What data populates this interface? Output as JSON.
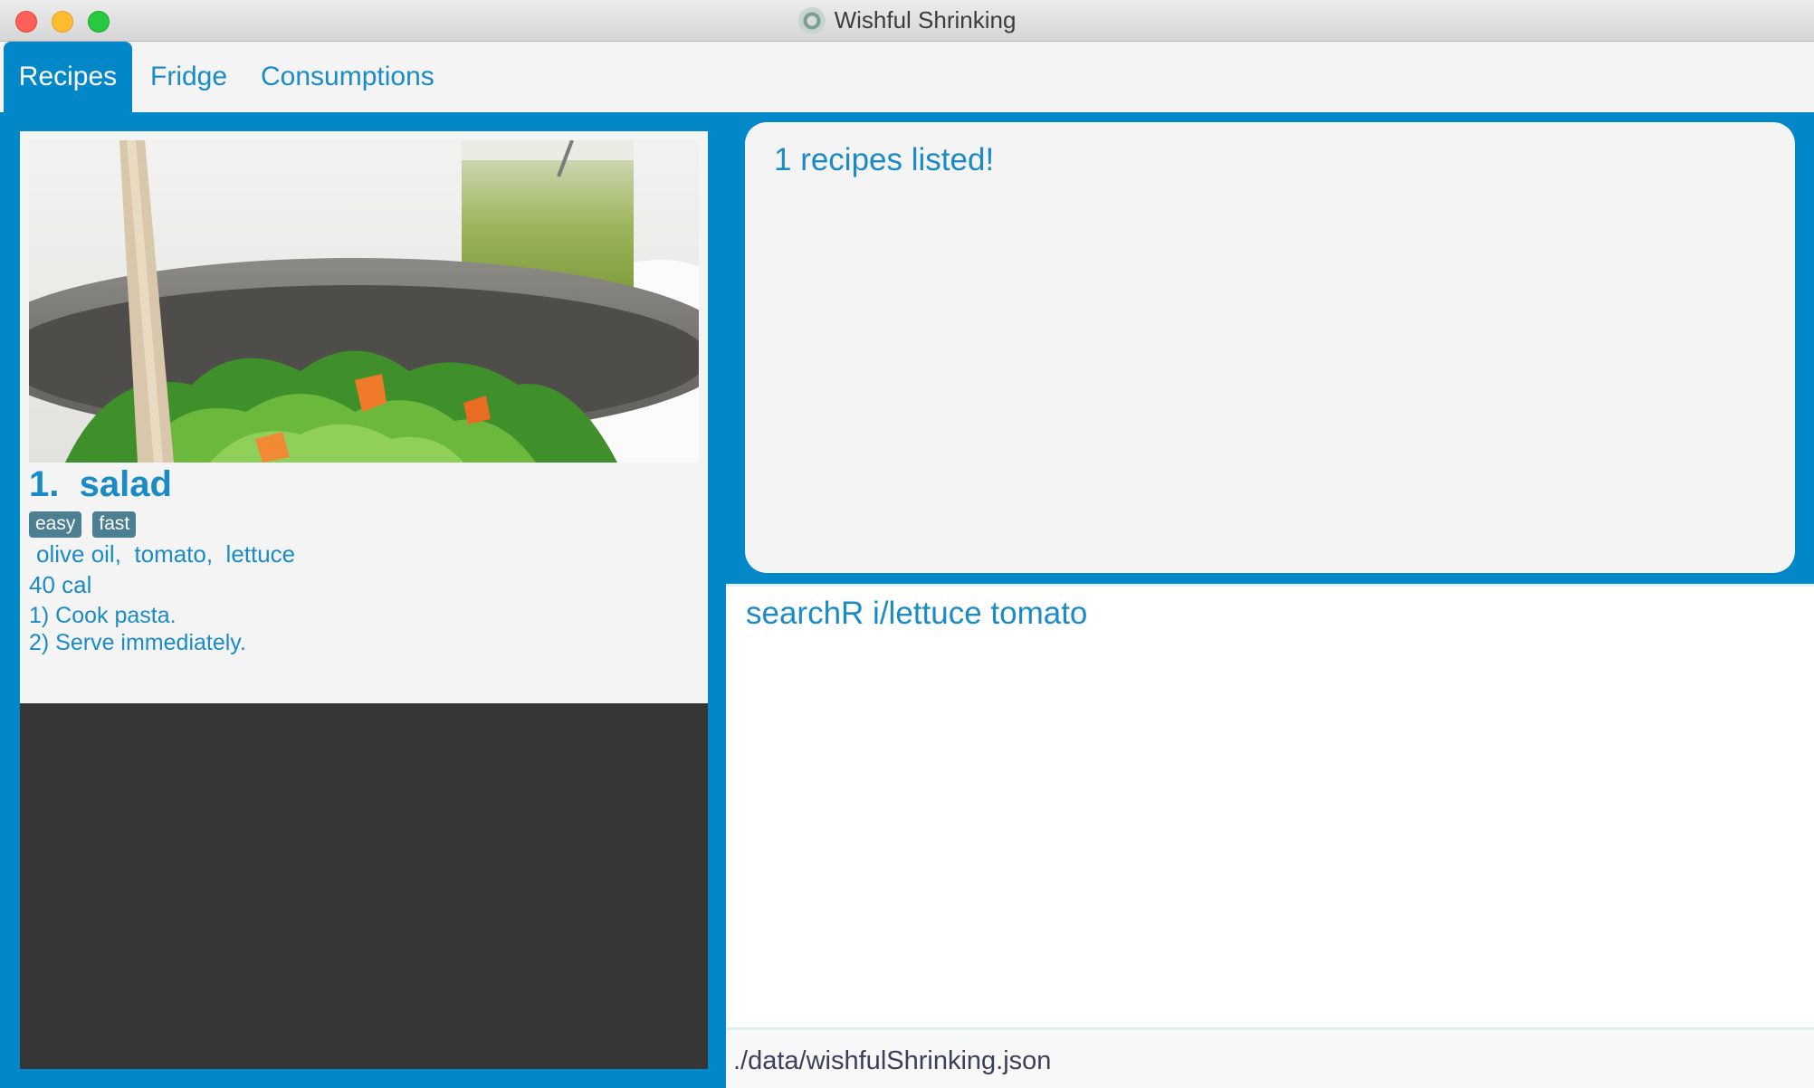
{
  "window": {
    "title": "Wishful Shrinking"
  },
  "tabs": [
    {
      "label": "Recipes",
      "active": true
    },
    {
      "label": "Fridge",
      "active": false
    },
    {
      "label": "Consumptions",
      "active": false
    }
  ],
  "recipe": {
    "name": "1.  salad",
    "tags": [
      "easy",
      "fast"
    ],
    "ingredients": "olive oil,  tomato,  lettuce",
    "calories": "40 cal",
    "steps": [
      "1) Cook pasta.",
      "2) Serve immediately."
    ]
  },
  "result": {
    "message": "1 recipes listed!"
  },
  "command": {
    "value": "searchR i/lettuce tomato"
  },
  "status": {
    "file_path": "./data/wishfulShrinking.json"
  },
  "colors": {
    "accent": "#0288c8",
    "text_blue": "#1a8bc7",
    "tag_bg": "#4d7f93",
    "panel_bg": "#f4f4f4",
    "list_bg": "#363636"
  }
}
